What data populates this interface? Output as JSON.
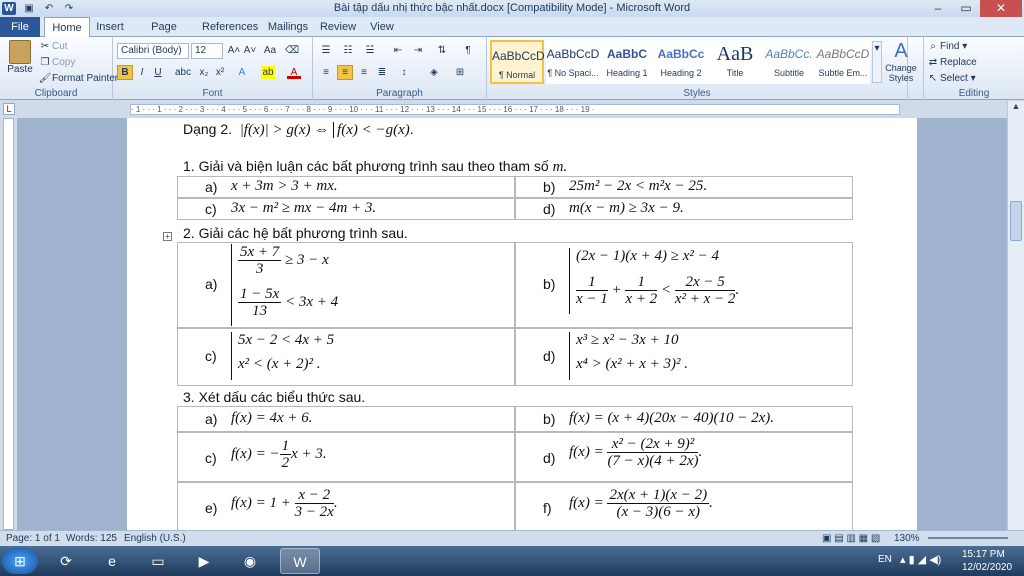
{
  "window": {
    "title": "Bài tập dấu nhị thức bậc nhất.docx [Compatibility Mode] - Microsoft Word"
  },
  "tabs": [
    "File",
    "Home",
    "Insert",
    "Page Layout",
    "References",
    "Mailings",
    "Review",
    "View"
  ],
  "ribbon": {
    "clipboard": {
      "label": "Clipboard",
      "paste": "Paste",
      "cut": "Cut",
      "copy": "Copy",
      "format_painter": "Format Painter"
    },
    "font": {
      "label": "Font",
      "family": "Calibri (Body)",
      "size": "12"
    },
    "paragraph": {
      "label": "Paragraph"
    },
    "styles": {
      "label": "Styles",
      "items": [
        {
          "sample": "AaBbCcD",
          "name": "¶ Normal"
        },
        {
          "sample": "AaBbCcD",
          "name": "¶ No Spaci..."
        },
        {
          "sample": "AaBbC",
          "name": "Heading 1"
        },
        {
          "sample": "AaBbCc",
          "name": "Heading 2"
        },
        {
          "sample": "AaB",
          "name": "Title"
        },
        {
          "sample": "AaBbCc.",
          "name": "Subtitle"
        },
        {
          "sample": "AaBbCcD",
          "name": "Subtle Em..."
        }
      ],
      "change_styles": "Change Styles"
    },
    "editing": {
      "label": "Editing",
      "find": "Find",
      "replace": "Replace",
      "select": "Select"
    }
  },
  "document": {
    "dang2_prefix": "Dạng 2.",
    "sec1": "1. Giải và biện luận các bất phương trình sau theo tham số",
    "sec1_var": "m.",
    "sec2": "2. Giải các hệ bất phương trình sau.",
    "sec3": "3. Xét dấu các biểu thức sau.",
    "labels": {
      "a": "a)",
      "b": "b)",
      "c": "c)",
      "d": "d)",
      "e": "e)",
      "f": "f)"
    }
  },
  "status": {
    "page": "Page: 1 of 1",
    "words": "Words: 125",
    "lang": "English (U.S.)",
    "zoom": "130%"
  },
  "taskbar": {
    "lang": "EN",
    "time": "15:17 PM",
    "date": "12/02/2020"
  }
}
